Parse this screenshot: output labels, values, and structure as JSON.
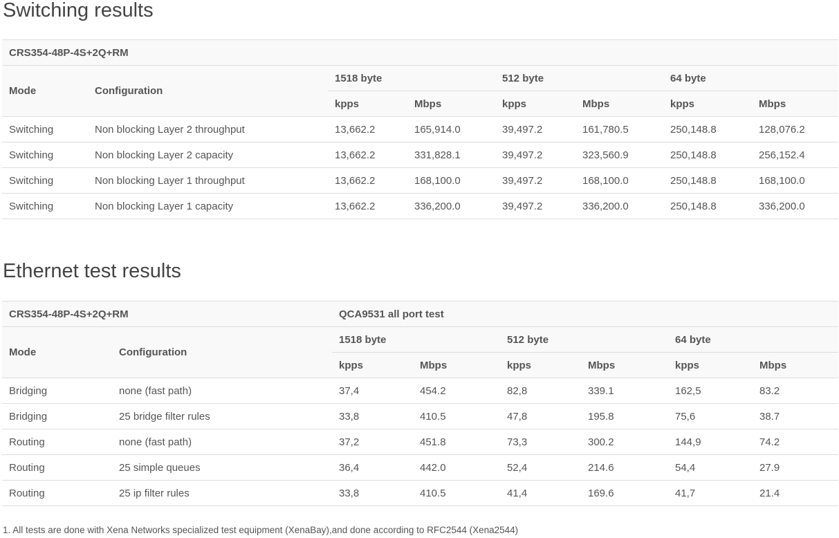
{
  "switching": {
    "title": "Switching results",
    "model": "CRS354-48P-4S+2Q+RM",
    "col_mode": "Mode",
    "col_config": "Configuration",
    "groups": [
      "1518 byte",
      "512 byte",
      "64 byte"
    ],
    "units": [
      "kpps",
      "Mbps",
      "kpps",
      "Mbps",
      "kpps",
      "Mbps"
    ],
    "rows": [
      [
        "Switching",
        "Non blocking Layer 2 throughput",
        "13,662.2",
        "165,914.0",
        "39,497.2",
        "161,780.5",
        "250,148.8",
        "128,076.2"
      ],
      [
        "Switching",
        "Non blocking Layer 2 capacity",
        "13,662.2",
        "331,828.1",
        "39,497.2",
        "323,560.9",
        "250,148.8",
        "256,152.4"
      ],
      [
        "Switching",
        "Non blocking Layer 1 throughput",
        "13,662.2",
        "168,100.0",
        "39,497.2",
        "168,100.0",
        "250,148.8",
        "168,100.0"
      ],
      [
        "Switching",
        "Non blocking Layer 1 capacity",
        "13,662.2",
        "336,200.0",
        "39,497.2",
        "336,200.0",
        "250,148.8",
        "336,200.0"
      ]
    ]
  },
  "ethernet": {
    "title": "Ethernet test results",
    "model": "CRS354-48P-4S+2Q+RM",
    "test_name": "QCA9531 all port test",
    "col_mode": "Mode",
    "col_config": "Configuration",
    "groups": [
      "1518 byte",
      "512 byte",
      "64 byte"
    ],
    "units": [
      "kpps",
      "Mbps",
      "kpps",
      "Mbps",
      "kpps",
      "Mbps"
    ],
    "rows": [
      [
        "Bridging",
        "none (fast path)",
        "37,4",
        "454.2",
        "82,8",
        "339.1",
        "162,5",
        "83.2"
      ],
      [
        "Bridging",
        "25 bridge filter rules",
        "33,8",
        "410.5",
        "47,8",
        "195.8",
        "75,6",
        "38.7"
      ],
      [
        "Routing",
        "none (fast path)",
        "37,2",
        "451.8",
        "73,3",
        "300.2",
        "144,9",
        "74.2"
      ],
      [
        "Routing",
        "25 simple queues",
        "36,4",
        "442.0",
        "52,4",
        "214.6",
        "54,4",
        "27.9"
      ],
      [
        "Routing",
        "25 ip filter rules",
        "33,8",
        "410.5",
        "41,4",
        "169.6",
        "41,7",
        "21.4"
      ]
    ]
  },
  "footnote": "1. All tests are done with Xena Networks specialized test equipment (XenaBay),and done according to RFC2544 (Xena2544)"
}
